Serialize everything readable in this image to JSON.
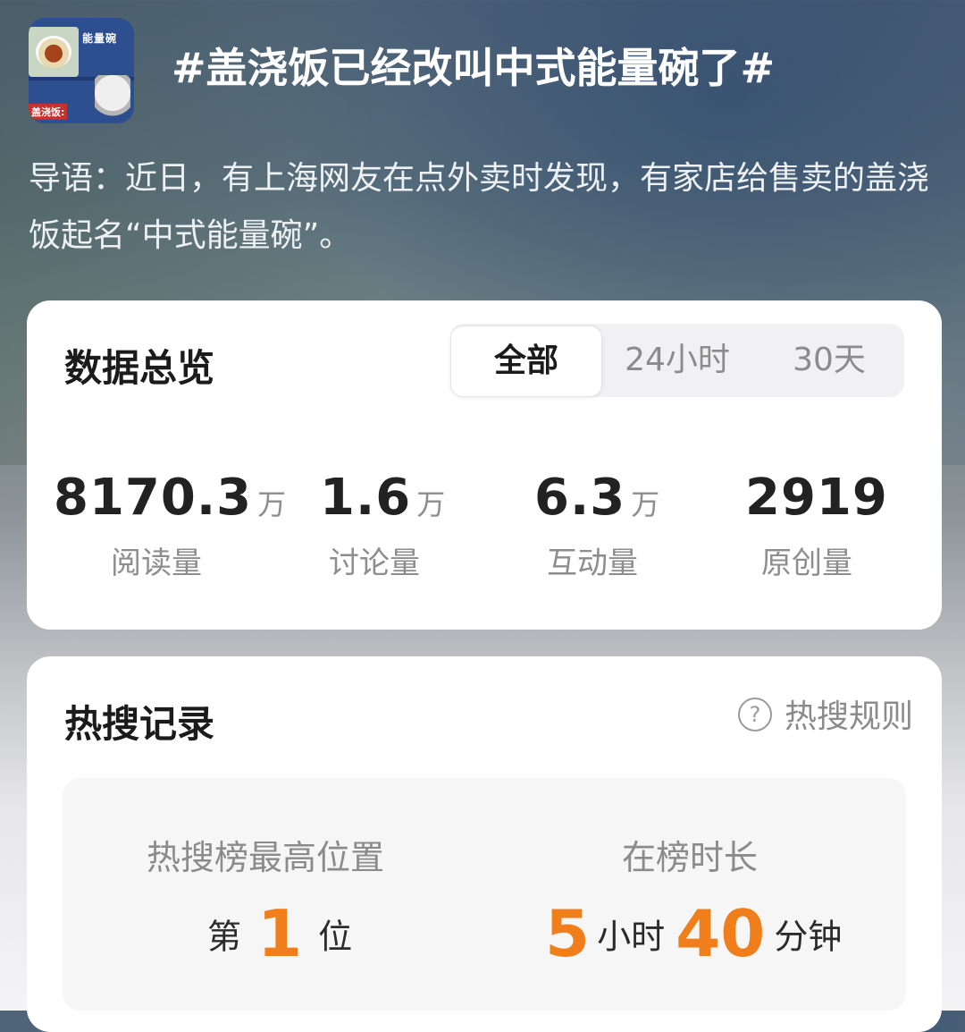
{
  "topic": {
    "thumbnail": {
      "label_top": "能量碗",
      "label_bottom": "盖浇饭:"
    },
    "title": "#盖浇饭已经改叫中式能量碗了#",
    "intro": "导语：近日，有上海网友在点外卖时发现，有家店给售卖的盖浇饭起名“中式能量碗”。"
  },
  "overview": {
    "title": "数据总览",
    "tabs": [
      {
        "label": "全部",
        "active": true
      },
      {
        "label": "24小时",
        "active": false
      },
      {
        "label": "30天",
        "active": false
      }
    ],
    "stats": [
      {
        "value": "8170.3",
        "unit": "万",
        "label": "阅读量"
      },
      {
        "value": "1.6",
        "unit": "万",
        "label": "讨论量"
      },
      {
        "value": "6.3",
        "unit": "万",
        "label": "互动量"
      },
      {
        "value": "2919",
        "unit": "",
        "label": "原创量"
      }
    ]
  },
  "hot_search": {
    "title": "热搜记录",
    "rules_label": "热搜规则",
    "rules_icon": "question-circle-icon",
    "highest_position": {
      "label": "热搜榜最高位置",
      "prefix": "第",
      "value": "1",
      "suffix": "位"
    },
    "duration": {
      "label": "在榜时长",
      "hours": "5",
      "hours_unit": "小时",
      "minutes": "40",
      "minutes_unit": "分钟"
    }
  },
  "colors": {
    "accent_orange": "#f07f1b",
    "card_bg": "#ffffff",
    "muted_text": "#8b8b8b"
  }
}
